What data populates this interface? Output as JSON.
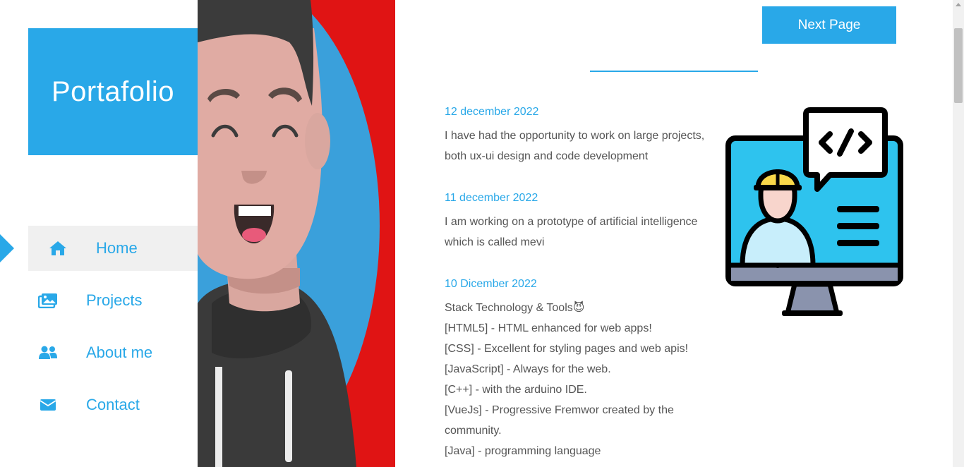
{
  "brand": {
    "title": "Portafolio",
    "color": "#29a8e8"
  },
  "nav": {
    "items": [
      {
        "label": "Home",
        "icon": "home-icon",
        "active": true
      },
      {
        "label": "Projects",
        "icon": "images-icon",
        "active": false
      },
      {
        "label": "About me",
        "icon": "users-icon",
        "active": false
      },
      {
        "label": "Contact",
        "icon": "envelope-icon",
        "active": false
      }
    ]
  },
  "header": {
    "next_label": "Next Page"
  },
  "posts": [
    {
      "date": "12 december 2022",
      "text_lines": [
        "I have had the opportunity to work on large projects,",
        "both ux-ui design and code development"
      ]
    },
    {
      "date": "11 december 2022",
      "text_lines": [
        "I am working on a prototype of artificial intelligence",
        "which is called mevi"
      ]
    },
    {
      "date": "10 Dicember 2022",
      "title": "Stack Technology & Tools",
      "title_emoji": "😈",
      "items": [
        "[HTML5] - HTML enhanced for web apps!",
        "[CSS] - Excellent for styling pages and web apis!",
        "[JavaScript] - Always for the web.",
        "[C++] - with the arduino IDE.",
        "[VueJs] - Progressive Fremwor created by the",
        "community.",
        "[Java] - programming language"
      ]
    }
  ],
  "colors": {
    "accent": "#29a8e8",
    "hero_bg": "#e01414",
    "text": "#555555"
  }
}
